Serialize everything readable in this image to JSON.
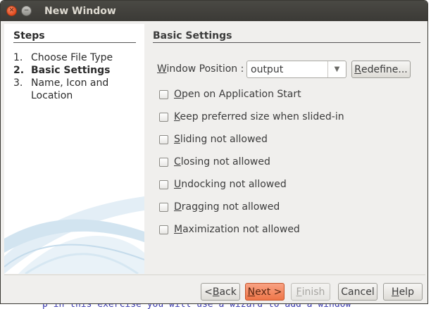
{
  "window": {
    "title": "New Window",
    "controls": [
      "close-icon",
      "minimize-icon"
    ]
  },
  "steps": {
    "title": "Steps",
    "items": [
      {
        "num": "1.",
        "label": "Choose File Type",
        "current": false
      },
      {
        "num": "2.",
        "label": "Basic Settings",
        "current": true
      },
      {
        "num": "3.",
        "label": "Name, Icon and Location",
        "current": false
      }
    ]
  },
  "main": {
    "title": "Basic Settings",
    "window_position": {
      "label_pre": "",
      "label_mnemonic": "W",
      "label_post": "indow Position :",
      "value": "output"
    },
    "redefine": {
      "mnemonic": "R",
      "rest": "edefine..."
    },
    "checkboxes": [
      {
        "mnemonic": "O",
        "rest": "pen on Application Start",
        "checked": false
      },
      {
        "mnemonic": "K",
        "rest": "eep preferred size when slided-in",
        "checked": false
      },
      {
        "mnemonic": "S",
        "rest": "liding not allowed",
        "checked": false
      },
      {
        "mnemonic": "C",
        "rest": "losing not allowed",
        "checked": false
      },
      {
        "mnemonic": "U",
        "rest": "ndocking not allowed",
        "checked": false
      },
      {
        "mnemonic": "D",
        "rest": "ragging not allowed",
        "checked": false
      },
      {
        "mnemonic": "M",
        "rest": "aximization not allowed",
        "checked": false
      }
    ]
  },
  "footer": {
    "back": {
      "pre": "<",
      "mnemonic": "B",
      "rest": "ack"
    },
    "next": {
      "mnemonic": "N",
      "rest": "ext >"
    },
    "finish": {
      "mnemonic": "F",
      "rest": "inish"
    },
    "cancel": {
      "label": "Cancel"
    },
    "help": {
      "mnemonic": "H",
      "rest": "elp"
    }
  },
  "background": {
    "bottom_text": "p in this exercise you will use a wizard to add a window"
  },
  "colors": {
    "titlebar": "#3b3a36",
    "accent_button": "#ef7548",
    "window_bg": "#f0efed"
  }
}
